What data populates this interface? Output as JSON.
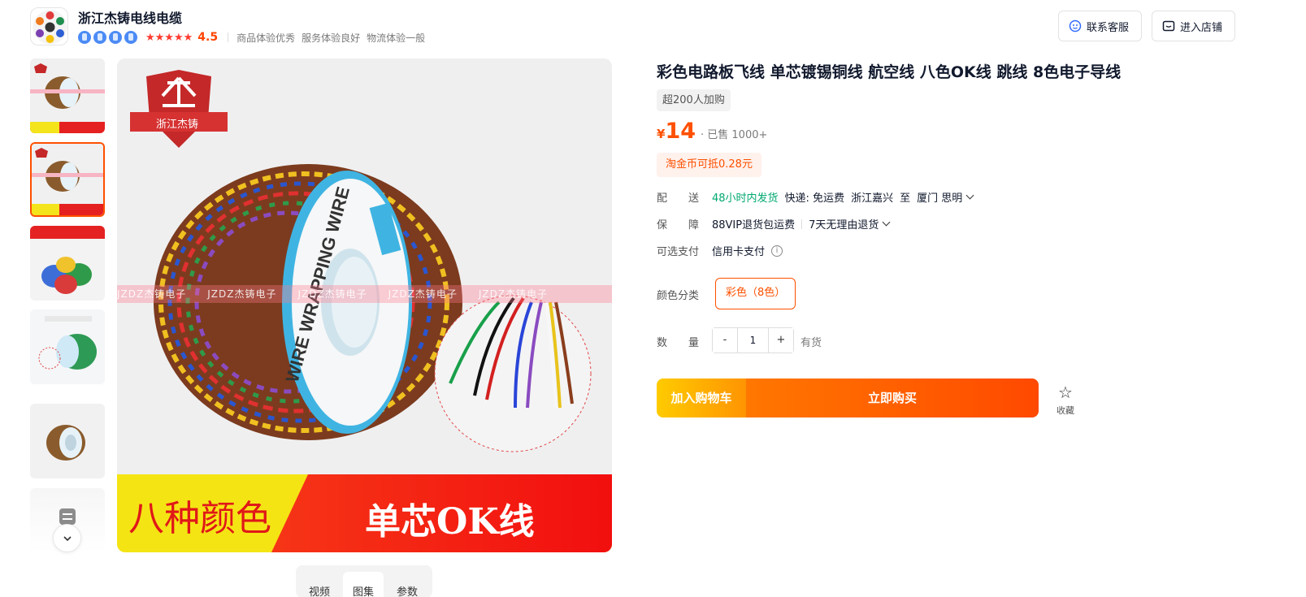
{
  "shop": {
    "name": "浙江杰铸电线电缆",
    "stars": "★★★★★",
    "score": "4.5",
    "meta": [
      "商品体验优秀",
      "服务体验良好",
      "物流体验一般"
    ],
    "service_button": "联系客服",
    "store_button": "进入店铺"
  },
  "gallery": {
    "watermark": "JZDZ杰铸电子　　JZDZ杰铸电子　　JZDZ杰铸电子　　JZDZ杰铸电子　　JZDZ杰铸电子",
    "shield_text": "浙江杰铸",
    "banner_left": "八种颜色",
    "banner_right": "单芯OK线",
    "tabs": [
      "视频",
      "图集",
      "参数"
    ],
    "active_thumb": 2
  },
  "product": {
    "title": "彩色电路板飞线 单芯镀锡铜线 航空线 八色OK线 跳线 8色电子导线",
    "tag": "超200人加购",
    "price_symbol": "¥",
    "price": "14",
    "sold": "· 已售 1000+",
    "coin_tag": "淘金币可抵0.28元",
    "delivery": {
      "label": "配　　送",
      "speed": "48小时内发货",
      "fee": "快递: 免运费",
      "from": "浙江嘉兴",
      "to_word": "至",
      "dest": "厦门 思明"
    },
    "guarantee": {
      "label": "保　　障",
      "item1": "88VIP退货包运费",
      "item2": "7天无理由退货"
    },
    "payment": {
      "label": "可选支付",
      "value": "信用卡支付",
      "info_icon": "i"
    },
    "color": {
      "label": "颜色分类",
      "option": "彩色（8色）"
    },
    "quantity": {
      "label": "数　　量",
      "minus": "-",
      "value": "1",
      "plus": "+",
      "stock": "有货"
    },
    "add_to_cart": "加入购物车",
    "buy_now": "立即购买",
    "favorite": "收藏"
  },
  "colors": {
    "accent": "#ff5000",
    "green": "#00a870",
    "cart_gradient": [
      "#ffcb00",
      "#ff9402"
    ],
    "buy_gradient": [
      "#ff7700",
      "#ff4900"
    ]
  }
}
